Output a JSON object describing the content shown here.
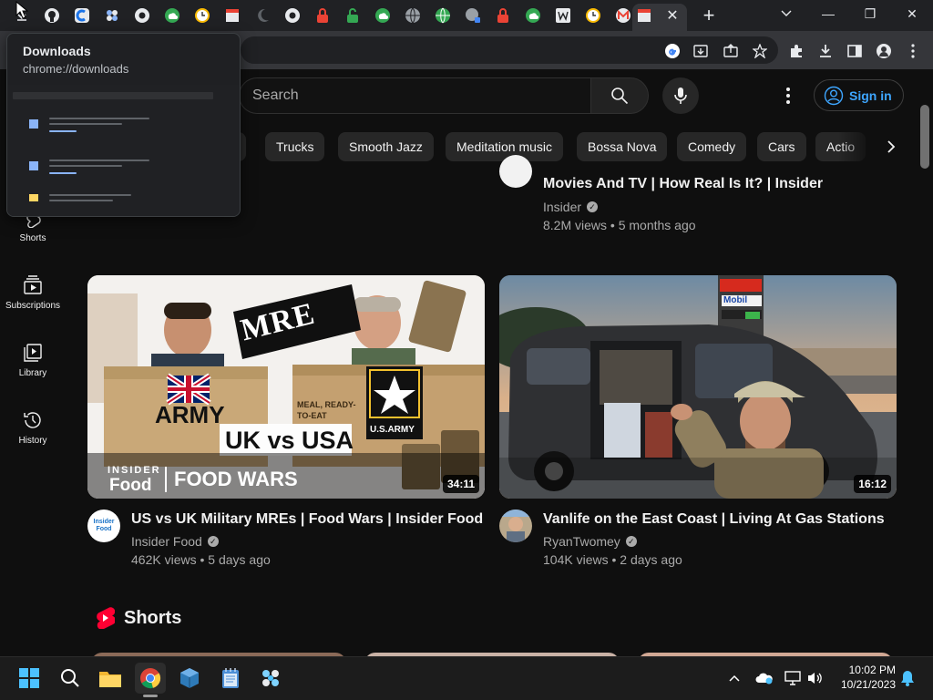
{
  "browser": {
    "new_tab_symbol": "+",
    "close_tab_symbol": "✕",
    "window_controls": {
      "minimize": "—",
      "maximize": "❐",
      "close": "✕"
    },
    "download_popup": {
      "title": "Downloads",
      "url": "chrome://downloads"
    }
  },
  "youtube": {
    "search": {
      "placeholder": "Search"
    },
    "sign_in": "Sign in",
    "chips": [
      "Trucks",
      "Smooth Jazz",
      "Meditation music",
      "Bossa Nova",
      "Comedy",
      "Cars",
      "Actio"
    ],
    "guide": [
      {
        "label": "Shorts",
        "icon": "shorts-icon"
      },
      {
        "label": "Subscriptions",
        "icon": "subscriptions-icon"
      },
      {
        "label": "Library",
        "icon": "library-icon"
      },
      {
        "label": "History",
        "icon": "history-icon"
      }
    ],
    "top_video": {
      "title": "Movies And TV | How Real Is It? | Insider",
      "channel": "Insider",
      "meta": "8.2M views • 5 months ago"
    },
    "videos": [
      {
        "title": "US vs UK Military MREs | Food Wars | Insider Food",
        "channel": "Insider Food",
        "meta": "462K views • 5 days ago",
        "duration": "34:11",
        "thumb_text": {
          "mre": "MRE",
          "army": "ARMY",
          "uk_vs_usa": "UK vs USA",
          "insider": "INSIDER",
          "food": "Food",
          "food_wars": "FOOD WARS",
          "us_army": "U.S.ARMY",
          "meal_ready": "MEAL, READY-TO-EAT"
        },
        "avatar_text": "Insider\nFood"
      },
      {
        "title": "Vanlife on the East Coast | Living At Gas Stations",
        "channel": "RyanTwomey",
        "meta": "104K views • 2 days ago",
        "duration": "16:12",
        "thumb_text": {
          "mobil": "Mobil"
        }
      }
    ],
    "shorts_header": "Shorts"
  },
  "taskbar": {
    "time": "10:02 PM",
    "date": "10/21/2023"
  }
}
